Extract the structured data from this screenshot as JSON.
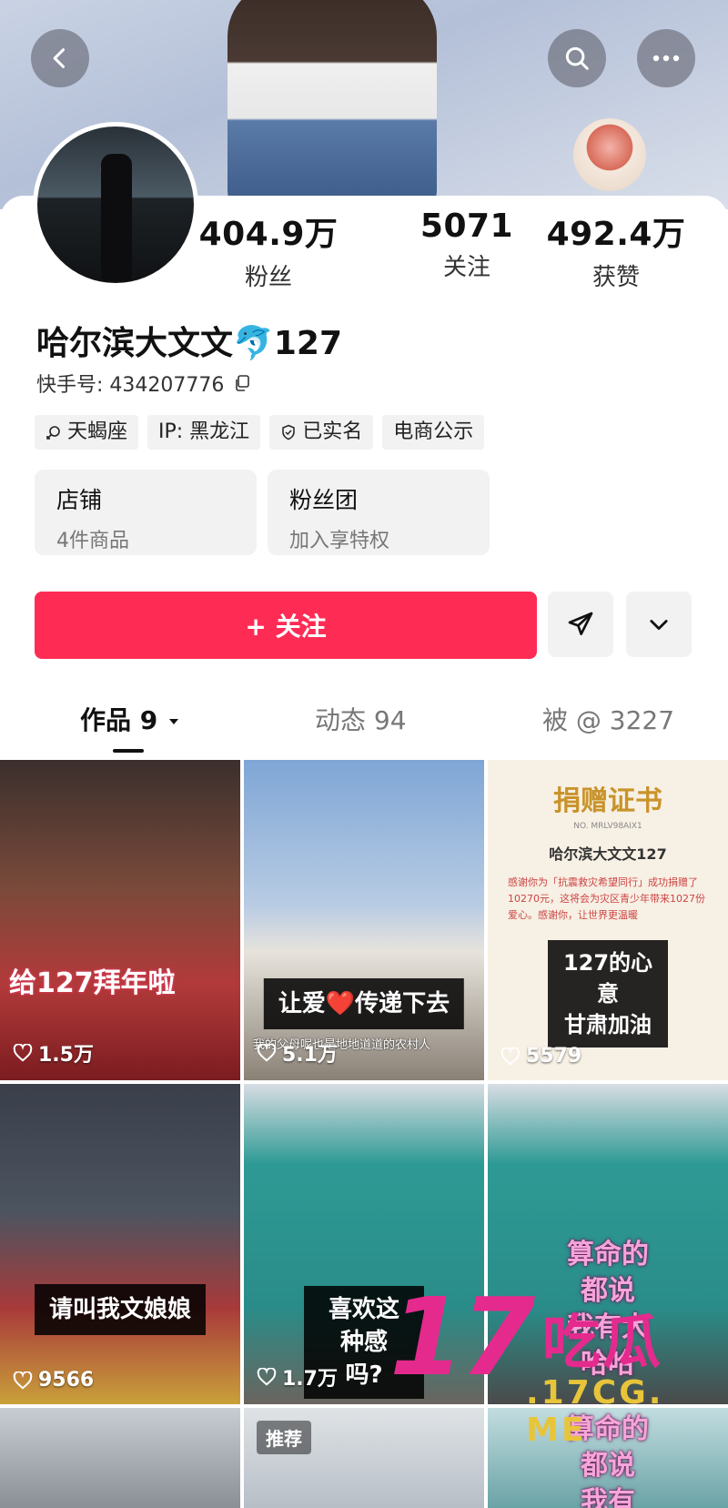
{
  "header": {
    "back_icon": "chevron-left-icon",
    "search_icon": "search-icon",
    "more_icon": "more-dots-icon"
  },
  "profile": {
    "stats": [
      {
        "value": "404.9万",
        "label": "粉丝"
      },
      {
        "value": "5071",
        "label": "关注"
      },
      {
        "value": "492.4万",
        "label": "获赞"
      }
    ],
    "name": "哈尔滨大文文",
    "name_emoji": "🐬",
    "name_suffix": "127",
    "uid": "快手号: 434207776",
    "tags": [
      "天蝎座",
      "IP: 黑龙江",
      "已实名",
      "电商公示"
    ],
    "boxes": [
      {
        "title": "店铺",
        "sub": "4件商品"
      },
      {
        "title": "粉丝团",
        "sub": "加入享特权"
      }
    ],
    "follow_label": "+ 关注"
  },
  "tabs": [
    {
      "label": "作品 9",
      "active": true
    },
    {
      "label": "动态 94",
      "active": false
    },
    {
      "label": "被 @ 3227",
      "active": false
    }
  ],
  "grid": [
    {
      "caption": "给127拜年啦",
      "likes": "1.5万"
    },
    {
      "caption": "让爱❤️传递下去",
      "subtitle": "我的父母呢也是地地道道的农村人",
      "likes": "5.1万"
    },
    {
      "cert_title": "捐赠证书",
      "cert_no": "NO. MRLV98AIX1",
      "cert_name": "哈尔滨大文文127",
      "cert_body": "感谢你为「抗震救灾希望同行」成功捐赠了10270元，这将会为灾区青少年带来1027份爱心。感谢你，让世界更温暖",
      "caption": "127的心意\n甘肃加油",
      "likes": "5579"
    },
    {
      "caption": "请叫我文娘娘",
      "likes": "9566"
    },
    {
      "caption": "喜欢这种感\n吗?",
      "likes": "1.7万"
    },
    {
      "caption": "算命的都说\n我有大哈哈",
      "likes": ""
    },
    {
      "badge": "推荐"
    },
    {
      "badge": ""
    },
    {
      "caption": "算命的都说\n我有"
    }
  ],
  "watermark": {
    "big": "17",
    "cn": "吃瓜",
    "url": ".17CG. ME"
  },
  "colors": {
    "accent": "#fe2c55",
    "watermark": "#e52a8e"
  }
}
